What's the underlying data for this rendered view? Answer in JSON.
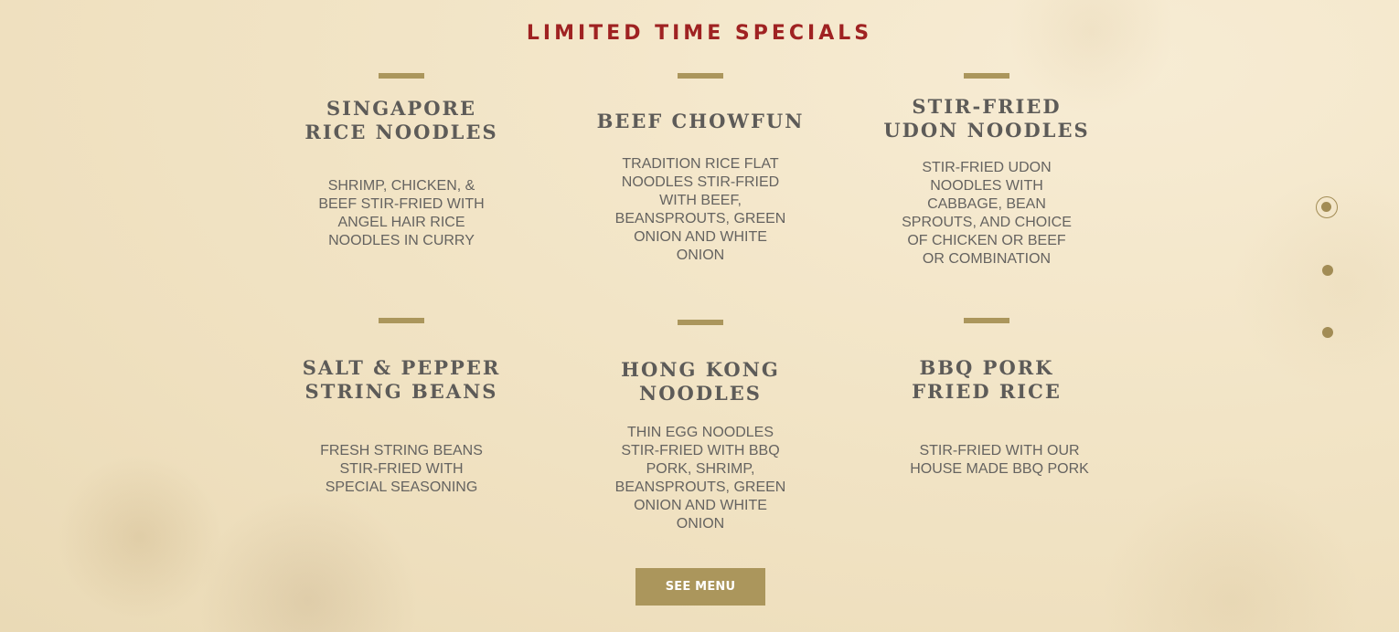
{
  "section": {
    "title": "LIMITED TIME SPECIALS"
  },
  "specials": [
    {
      "name": "SINGAPORE RICE NOODLES",
      "description": "SHRIMP, CHICKEN, & BEEF STIR-FRIED WITH ANGEL HAIR RICE NOODLES IN CURRY"
    },
    {
      "name": "BEEF CHOWFUN",
      "description": "TRADITION RICE FLAT NOODLES STIR-FRIED WITH BEEF, BEANSPROUTS, GREEN ONION AND WHITE ONION"
    },
    {
      "name": "STIR-FRIED UDON NOODLES",
      "description": "STIR-FRIED UDON NOODLES WITH CABBAGE, BEAN SPROUTS, AND CHOICE OF CHICKEN OR BEEF OR COMBINATION"
    },
    {
      "name": "SALT & PEPPER STRING BEANS",
      "description": "FRESH STRING BEANS STIR-FRIED WITH SPECIAL SEASONING"
    },
    {
      "name": "HONG KONG NOODLES",
      "description": "THIN EGG NOODLES STIR-FRIED WITH BBQ PORK, SHRIMP, BEANSPROUTS, GREEN ONION AND WHITE ONION"
    },
    {
      "name": "BBQ PORK FRIED RICE",
      "description": "STIR-FRIED WITH OUR HOUSE MADE BBQ PORK"
    }
  ],
  "cta": {
    "label": "SEE MENU"
  },
  "slide_nav": {
    "count": 3,
    "active_index": 0
  },
  "colors": {
    "title": "#9f2222",
    "accent": "#ab965c",
    "text": "#5d5b58",
    "background": "#f3e6c9"
  }
}
